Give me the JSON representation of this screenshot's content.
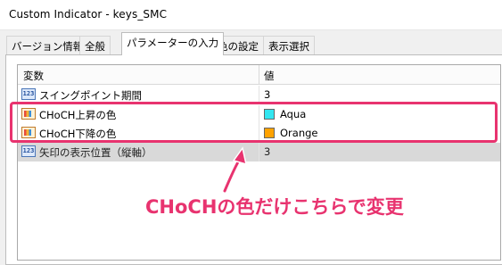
{
  "window": {
    "title": "Custom Indicator - keys_SMC"
  },
  "tabs": [
    {
      "label": "バージョン情報",
      "active": false
    },
    {
      "label": "全般",
      "active": false
    },
    {
      "label": "パラメーターの入力",
      "active": true
    },
    {
      "label": "色の設定",
      "active": false
    },
    {
      "label": "表示選択",
      "active": false
    }
  ],
  "grid": {
    "columns": {
      "variable": "変数",
      "value": "値"
    },
    "rows": [
      {
        "icon": "number-icon",
        "icon_text": "123",
        "name": "スイングポイント期間",
        "value": "3"
      },
      {
        "icon": "color-icon",
        "name": "CHoCH上昇の色",
        "value": "Aqua",
        "swatch": "#33e6f0"
      },
      {
        "icon": "color-icon",
        "name": "CHoCH下降の色",
        "value": "Orange",
        "swatch": "#ffa200"
      },
      {
        "icon": "number-icon",
        "icon_text": "123",
        "name": "矢印の表示位置（縦軸）",
        "value": "3",
        "selected": true
      }
    ]
  },
  "annotation": {
    "text": "CHoCHの色だけこちらで変更",
    "color": "#e8336f"
  }
}
